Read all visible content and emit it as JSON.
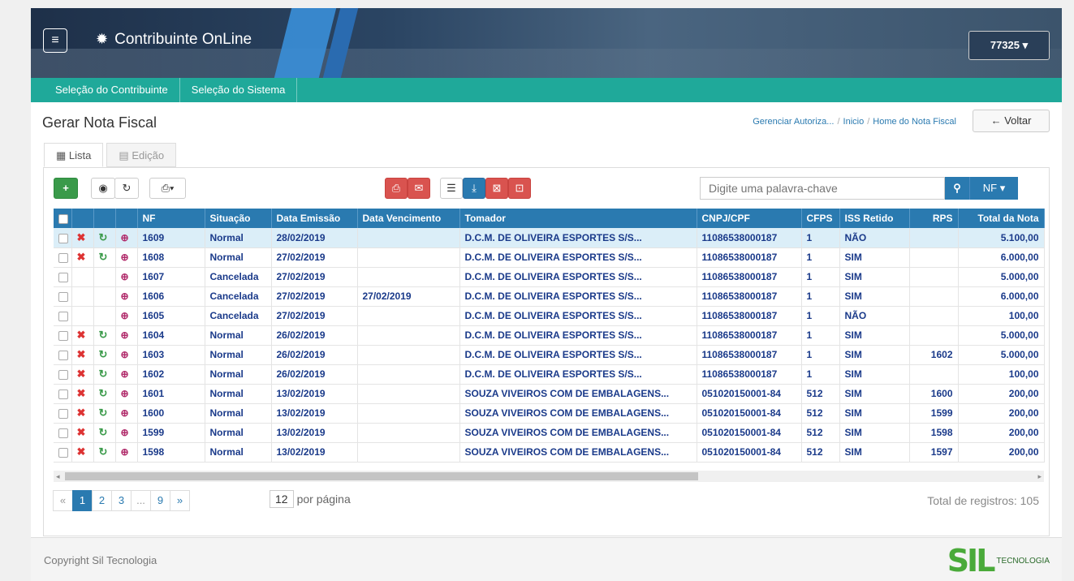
{
  "header": {
    "menu_icon": "≡",
    "app_title": "Contribuinte OnLine",
    "user_label": "77325"
  },
  "subnav": [
    "Seleção do Contribuinte",
    "Seleção do Sistema"
  ],
  "page": {
    "title": "Gerar Nota Fiscal",
    "breadcrumb": [
      "Gerenciar Autoriza...",
      "Inicio",
      "Home do Nota Fiscal"
    ],
    "back_label": "Voltar"
  },
  "tabs": [
    {
      "label": "Lista"
    },
    {
      "label": "Edição"
    }
  ],
  "toolbar": {
    "search_placeholder": "Digite uma palavra-chave",
    "nf_label": "NF"
  },
  "table": {
    "headers": [
      "NF",
      "Situação",
      "Data Emissão",
      "Data Vencimento",
      "Tomador",
      "CNPJ/CPF",
      "CFPS",
      "ISS Retido",
      "RPS",
      "Total da Nota"
    ],
    "rows": [
      [
        "1609",
        "Normal",
        "28/02/2019",
        "",
        "D.C.M. DE OLIVEIRA ESPORTES S/S...",
        "11086538000187",
        "1",
        "NÃO",
        "",
        "5.100,00"
      ],
      [
        "1608",
        "Normal",
        "27/02/2019",
        "",
        "D.C.M. DE OLIVEIRA ESPORTES S/S...",
        "11086538000187",
        "1",
        "SIM",
        "",
        "6.000,00"
      ],
      [
        "1607",
        "Cancelada",
        "27/02/2019",
        "",
        "D.C.M. DE OLIVEIRA ESPORTES S/S...",
        "11086538000187",
        "1",
        "SIM",
        "",
        "5.000,00"
      ],
      [
        "1606",
        "Cancelada",
        "27/02/2019",
        "27/02/2019",
        "D.C.M. DE OLIVEIRA ESPORTES S/S...",
        "11086538000187",
        "1",
        "SIM",
        "",
        "6.000,00"
      ],
      [
        "1605",
        "Cancelada",
        "27/02/2019",
        "",
        "D.C.M. DE OLIVEIRA ESPORTES S/S...",
        "11086538000187",
        "1",
        "NÃO",
        "",
        "100,00"
      ],
      [
        "1604",
        "Normal",
        "26/02/2019",
        "",
        "D.C.M. DE OLIVEIRA ESPORTES S/S...",
        "11086538000187",
        "1",
        "SIM",
        "",
        "5.000,00"
      ],
      [
        "1603",
        "Normal",
        "26/02/2019",
        "",
        "D.C.M. DE OLIVEIRA ESPORTES S/S...",
        "11086538000187",
        "1",
        "SIM",
        "1602",
        "5.000,00"
      ],
      [
        "1602",
        "Normal",
        "26/02/2019",
        "",
        "D.C.M. DE OLIVEIRA ESPORTES S/S...",
        "11086538000187",
        "1",
        "SIM",
        "",
        "100,00"
      ],
      [
        "1601",
        "Normal",
        "13/02/2019",
        "",
        "SOUZA VIVEIROS COM DE EMBALAGENS...",
        "051020150001-84",
        "512",
        "SIM",
        "1600",
        "200,00"
      ],
      [
        "1600",
        "Normal",
        "13/02/2019",
        "",
        "SOUZA VIVEIROS COM DE EMBALAGENS...",
        "051020150001-84",
        "512",
        "SIM",
        "1599",
        "200,00"
      ],
      [
        "1599",
        "Normal",
        "13/02/2019",
        "",
        "SOUZA VIVEIROS COM DE EMBALAGENS...",
        "051020150001-84",
        "512",
        "SIM",
        "1598",
        "200,00"
      ],
      [
        "1598",
        "Normal",
        "13/02/2019",
        "",
        "SOUZA VIVEIROS COM DE EMBALAGENS...",
        "051020150001-84",
        "512",
        "SIM",
        "1597",
        "200,00"
      ]
    ]
  },
  "pagination": {
    "pages": [
      "«",
      "1",
      "2",
      "3",
      "...",
      "9",
      "»"
    ],
    "per_page_value": "12",
    "per_page_label": "por página",
    "total_label": "Total de registros: 105"
  },
  "footer": {
    "copyright": "Copyright Sil Tecnologia",
    "logo_text": "SIL",
    "logo_sub": "TECNOLOGIA"
  }
}
